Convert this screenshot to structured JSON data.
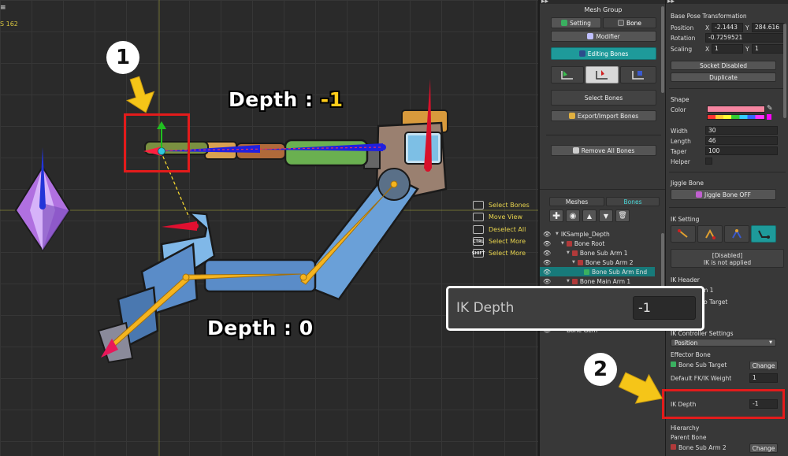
{
  "viewport": {
    "menu_icon": "≡",
    "fps_text": "S 162",
    "hints": [
      {
        "icon": "mouse-left-icon",
        "glyph": "",
        "label": "Select Bones"
      },
      {
        "icon": "mouse-middle-icon",
        "glyph": "",
        "label": "Move View"
      },
      {
        "icon": "mouse-right-icon",
        "glyph": "",
        "label": "Deselect All"
      },
      {
        "icon": "ctrl-key-icon",
        "glyph": "CTRL",
        "label": "Select More"
      },
      {
        "icon": "shift-key-icon",
        "glyph": "SHIFT",
        "label": "Select More"
      }
    ]
  },
  "annotations": {
    "step1": "1",
    "step2": "2",
    "depth_top_prefix": "Depth : ",
    "depth_top_value": "-1",
    "depth_bottom_prefix": "Depth : ",
    "depth_bottom_value": "0",
    "callout_label": "IK Depth",
    "callout_value": "-1"
  },
  "left_panel": {
    "title": "Mesh Group",
    "tab_setting": "Setting",
    "tab_bone": "Bone",
    "modifier": "Modifier",
    "editing_bones": "Editing Bones",
    "select_bones": "Select Bones",
    "export_import": "Export/Import Bones",
    "remove_all": "Remove All Bones",
    "tab_meshes": "Meshes",
    "tab_bones": "Bones",
    "tree": [
      {
        "label": "IKSample_Depth",
        "indent": 0
      },
      {
        "label": "Bone Root",
        "indent": 1
      },
      {
        "label": "Bone Sub Arm 1",
        "indent": 2
      },
      {
        "label": "Bone Sub Arm 2",
        "indent": 3
      },
      {
        "label": "Bone Sub Arm End",
        "indent": 4
      },
      {
        "label": "Bone Main Arm 1",
        "indent": 2
      },
      {
        "label": "Bone Gem",
        "indent": 2
      }
    ]
  },
  "right_panel": {
    "base_pose": "Base Pose Transformation",
    "position": "Position",
    "pos_x": "-2.1443",
    "pos_y": "284.616",
    "rotation": "Rotation",
    "rot_val": "-0.7259521",
    "scaling": "Scaling",
    "scale_x": "1",
    "scale_y": "1",
    "x": "X",
    "y": "Y",
    "socket": "Socket Disabled",
    "duplicate": "Duplicate",
    "shape": "Shape",
    "color": "Color",
    "width": "Width",
    "width_val": "30",
    "length": "Length",
    "length_val": "46",
    "taper": "Taper",
    "taper_val": "100",
    "helper": "Helper",
    "jiggle_bone": "Jiggle Bone",
    "jiggle_off": "Jiggle Bone OFF",
    "ik_setting": "IK Setting",
    "ik_disabled": "[Disabled]",
    "ik_not_applied": "IK is not applied",
    "ik_header": "IK Header",
    "ik_header_val": "ub Arm 1",
    "ik_target": "n to Target",
    "ik_controller": "IK Controller Settings",
    "position_option": "Position",
    "effector": "Effector Bone",
    "effector_val": "Bone Sub Target",
    "change": "Change",
    "default_fk": "Default FK/IK Weight",
    "default_fk_val": "1",
    "ik_depth": "IK Depth",
    "ik_depth_val": "-1",
    "hierarchy": "Hierarchy",
    "parent_bone": "Parent Bone",
    "parent_val": "Bone Sub Arm 2"
  },
  "colors": {
    "accent_teal": "#1e9a9a",
    "highlight_red": "#e31b1b",
    "depth_yellow": "#ffcc1a",
    "bone_blue": "#2020e0",
    "bone_orange": "#f5b41e",
    "bone_red": "#e01030"
  }
}
